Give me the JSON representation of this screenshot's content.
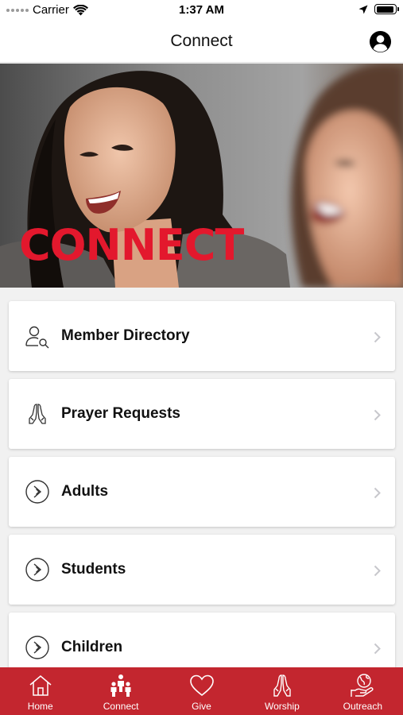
{
  "status_bar": {
    "carrier": "Carrier",
    "time": "1:37 AM",
    "battery_level": 0.95
  },
  "nav": {
    "title": "Connect"
  },
  "hero": {
    "text": "CONNECT"
  },
  "menu": {
    "items": [
      {
        "label": "Member Directory",
        "icon": "member-search-icon"
      },
      {
        "label": "Prayer Requests",
        "icon": "praying-hands-icon"
      },
      {
        "label": "Adults",
        "icon": "circle-chevron-icon"
      },
      {
        "label": "Students",
        "icon": "circle-chevron-icon"
      },
      {
        "label": "Children",
        "icon": "circle-chevron-icon"
      }
    ]
  },
  "tabs": [
    {
      "label": "Home",
      "icon": "home-icon"
    },
    {
      "label": "Connect",
      "icon": "people-icon"
    },
    {
      "label": "Give",
      "icon": "heart-icon"
    },
    {
      "label": "Worship",
      "icon": "praying-hands-icon"
    },
    {
      "label": "Outreach",
      "icon": "globe-hand-icon"
    }
  ],
  "colors": {
    "brand_red": "#c3262f",
    "hero_text_red": "#e3182d"
  }
}
